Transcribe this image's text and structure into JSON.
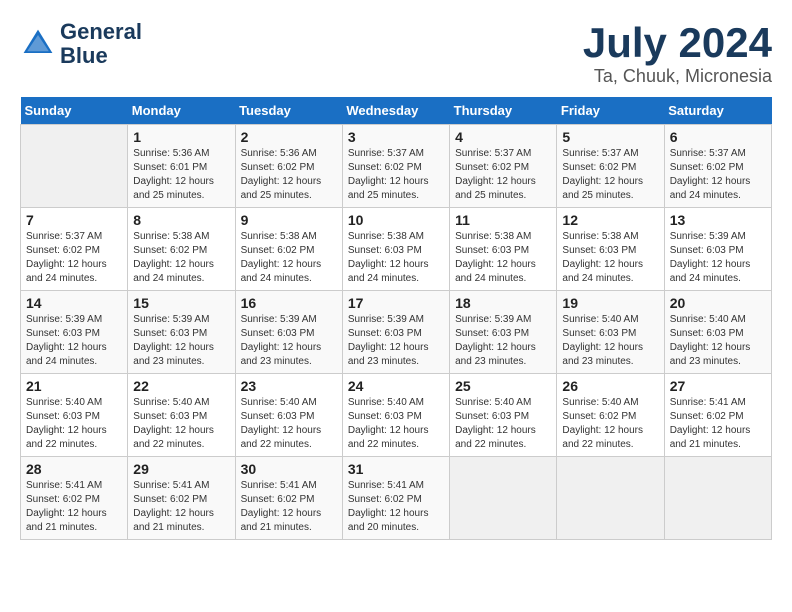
{
  "logo": {
    "line1": "General",
    "line2": "Blue"
  },
  "title": "July 2024",
  "location": "Ta, Chuuk, Micronesia",
  "weekdays": [
    "Sunday",
    "Monday",
    "Tuesday",
    "Wednesday",
    "Thursday",
    "Friday",
    "Saturday"
  ],
  "weeks": [
    [
      {
        "day": "",
        "sunrise": "",
        "sunset": "",
        "daylight": ""
      },
      {
        "day": "1",
        "sunrise": "Sunrise: 5:36 AM",
        "sunset": "Sunset: 6:01 PM",
        "daylight": "Daylight: 12 hours and 25 minutes."
      },
      {
        "day": "2",
        "sunrise": "Sunrise: 5:36 AM",
        "sunset": "Sunset: 6:02 PM",
        "daylight": "Daylight: 12 hours and 25 minutes."
      },
      {
        "day": "3",
        "sunrise": "Sunrise: 5:37 AM",
        "sunset": "Sunset: 6:02 PM",
        "daylight": "Daylight: 12 hours and 25 minutes."
      },
      {
        "day": "4",
        "sunrise": "Sunrise: 5:37 AM",
        "sunset": "Sunset: 6:02 PM",
        "daylight": "Daylight: 12 hours and 25 minutes."
      },
      {
        "day": "5",
        "sunrise": "Sunrise: 5:37 AM",
        "sunset": "Sunset: 6:02 PM",
        "daylight": "Daylight: 12 hours and 25 minutes."
      },
      {
        "day": "6",
        "sunrise": "Sunrise: 5:37 AM",
        "sunset": "Sunset: 6:02 PM",
        "daylight": "Daylight: 12 hours and 24 minutes."
      }
    ],
    [
      {
        "day": "7",
        "sunrise": "Sunrise: 5:37 AM",
        "sunset": "Sunset: 6:02 PM",
        "daylight": "Daylight: 12 hours and 24 minutes."
      },
      {
        "day": "8",
        "sunrise": "Sunrise: 5:38 AM",
        "sunset": "Sunset: 6:02 PM",
        "daylight": "Daylight: 12 hours and 24 minutes."
      },
      {
        "day": "9",
        "sunrise": "Sunrise: 5:38 AM",
        "sunset": "Sunset: 6:02 PM",
        "daylight": "Daylight: 12 hours and 24 minutes."
      },
      {
        "day": "10",
        "sunrise": "Sunrise: 5:38 AM",
        "sunset": "Sunset: 6:03 PM",
        "daylight": "Daylight: 12 hours and 24 minutes."
      },
      {
        "day": "11",
        "sunrise": "Sunrise: 5:38 AM",
        "sunset": "Sunset: 6:03 PM",
        "daylight": "Daylight: 12 hours and 24 minutes."
      },
      {
        "day": "12",
        "sunrise": "Sunrise: 5:38 AM",
        "sunset": "Sunset: 6:03 PM",
        "daylight": "Daylight: 12 hours and 24 minutes."
      },
      {
        "day": "13",
        "sunrise": "Sunrise: 5:39 AM",
        "sunset": "Sunset: 6:03 PM",
        "daylight": "Daylight: 12 hours and 24 minutes."
      }
    ],
    [
      {
        "day": "14",
        "sunrise": "Sunrise: 5:39 AM",
        "sunset": "Sunset: 6:03 PM",
        "daylight": "Daylight: 12 hours and 24 minutes."
      },
      {
        "day": "15",
        "sunrise": "Sunrise: 5:39 AM",
        "sunset": "Sunset: 6:03 PM",
        "daylight": "Daylight: 12 hours and 23 minutes."
      },
      {
        "day": "16",
        "sunrise": "Sunrise: 5:39 AM",
        "sunset": "Sunset: 6:03 PM",
        "daylight": "Daylight: 12 hours and 23 minutes."
      },
      {
        "day": "17",
        "sunrise": "Sunrise: 5:39 AM",
        "sunset": "Sunset: 6:03 PM",
        "daylight": "Daylight: 12 hours and 23 minutes."
      },
      {
        "day": "18",
        "sunrise": "Sunrise: 5:39 AM",
        "sunset": "Sunset: 6:03 PM",
        "daylight": "Daylight: 12 hours and 23 minutes."
      },
      {
        "day": "19",
        "sunrise": "Sunrise: 5:40 AM",
        "sunset": "Sunset: 6:03 PM",
        "daylight": "Daylight: 12 hours and 23 minutes."
      },
      {
        "day": "20",
        "sunrise": "Sunrise: 5:40 AM",
        "sunset": "Sunset: 6:03 PM",
        "daylight": "Daylight: 12 hours and 23 minutes."
      }
    ],
    [
      {
        "day": "21",
        "sunrise": "Sunrise: 5:40 AM",
        "sunset": "Sunset: 6:03 PM",
        "daylight": "Daylight: 12 hours and 22 minutes."
      },
      {
        "day": "22",
        "sunrise": "Sunrise: 5:40 AM",
        "sunset": "Sunset: 6:03 PM",
        "daylight": "Daylight: 12 hours and 22 minutes."
      },
      {
        "day": "23",
        "sunrise": "Sunrise: 5:40 AM",
        "sunset": "Sunset: 6:03 PM",
        "daylight": "Daylight: 12 hours and 22 minutes."
      },
      {
        "day": "24",
        "sunrise": "Sunrise: 5:40 AM",
        "sunset": "Sunset: 6:03 PM",
        "daylight": "Daylight: 12 hours and 22 minutes."
      },
      {
        "day": "25",
        "sunrise": "Sunrise: 5:40 AM",
        "sunset": "Sunset: 6:03 PM",
        "daylight": "Daylight: 12 hours and 22 minutes."
      },
      {
        "day": "26",
        "sunrise": "Sunrise: 5:40 AM",
        "sunset": "Sunset: 6:02 PM",
        "daylight": "Daylight: 12 hours and 22 minutes."
      },
      {
        "day": "27",
        "sunrise": "Sunrise: 5:41 AM",
        "sunset": "Sunset: 6:02 PM",
        "daylight": "Daylight: 12 hours and 21 minutes."
      }
    ],
    [
      {
        "day": "28",
        "sunrise": "Sunrise: 5:41 AM",
        "sunset": "Sunset: 6:02 PM",
        "daylight": "Daylight: 12 hours and 21 minutes."
      },
      {
        "day": "29",
        "sunrise": "Sunrise: 5:41 AM",
        "sunset": "Sunset: 6:02 PM",
        "daylight": "Daylight: 12 hours and 21 minutes."
      },
      {
        "day": "30",
        "sunrise": "Sunrise: 5:41 AM",
        "sunset": "Sunset: 6:02 PM",
        "daylight": "Daylight: 12 hours and 21 minutes."
      },
      {
        "day": "31",
        "sunrise": "Sunrise: 5:41 AM",
        "sunset": "Sunset: 6:02 PM",
        "daylight": "Daylight: 12 hours and 20 minutes."
      },
      {
        "day": "",
        "sunrise": "",
        "sunset": "",
        "daylight": ""
      },
      {
        "day": "",
        "sunrise": "",
        "sunset": "",
        "daylight": ""
      },
      {
        "day": "",
        "sunrise": "",
        "sunset": "",
        "daylight": ""
      }
    ]
  ]
}
